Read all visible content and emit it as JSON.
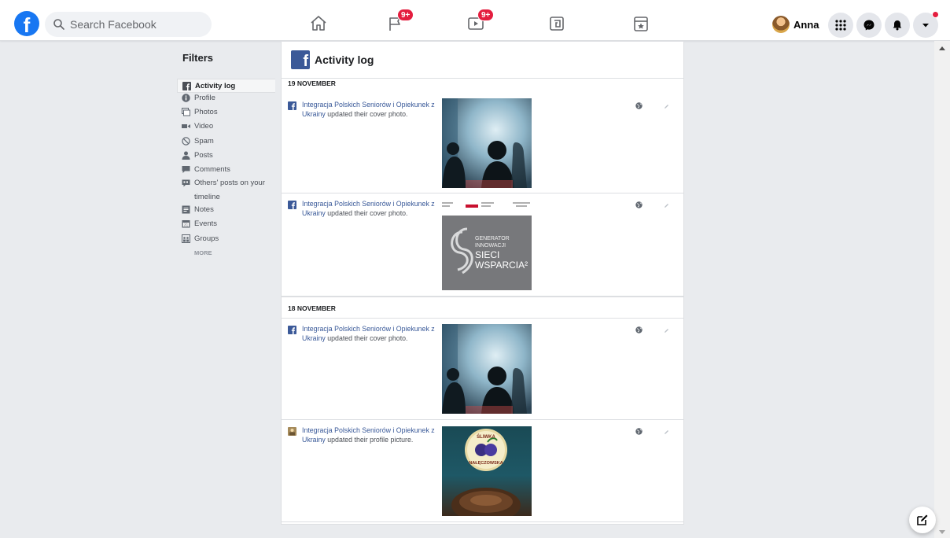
{
  "topbar": {
    "logo_icon": "facebook-logo-icon",
    "search_placeholder": "Search Facebook",
    "nav_items": [
      {
        "name": "home",
        "icon": "home-icon"
      },
      {
        "name": "pages",
        "icon": "flag-icon",
        "badge": "9+"
      },
      {
        "name": "watch",
        "icon": "video-icon",
        "badge": "9+"
      },
      {
        "name": "groups",
        "icon": "groups-icon"
      },
      {
        "name": "gaming",
        "icon": "star-calendar-icon"
      }
    ],
    "profile_name": "Anna",
    "right_buttons": [
      "menu-grid-icon",
      "messenger-icon",
      "notifications-icon",
      "account-caret-icon"
    ]
  },
  "filters": {
    "title": "Filters",
    "items": [
      {
        "label": "Activity log",
        "icon": "facebook-square-icon",
        "active": true
      },
      {
        "label": "Profile",
        "icon": "info-circle-icon"
      },
      {
        "label": "Photos",
        "icon": "photos-icon"
      },
      {
        "label": "Video",
        "icon": "video-camera-icon"
      },
      {
        "label": "Spam",
        "icon": "block-icon"
      },
      {
        "label": "Posts",
        "icon": "person-icon"
      },
      {
        "label": "Comments",
        "icon": "comment-icon"
      },
      {
        "label": "Others' posts on your timeline",
        "icon": "speech-bubble-icon"
      },
      {
        "label": "Notes",
        "icon": "note-icon"
      },
      {
        "label": "Events",
        "icon": "calendar-icon"
      },
      {
        "label": "Groups",
        "icon": "group-icon"
      }
    ],
    "more_label": "MORE"
  },
  "activity_log": {
    "title": "Activity log",
    "days": [
      {
        "label": "19 NOVEMBER",
        "entries": [
          {
            "actor": "Integracja Polskich Seniorów i Opiekunek z Ukrainy",
            "action": " updated their cover photo.",
            "thumb": "concert-photo"
          },
          {
            "actor": "Integracja Polskich Seniorów i Opiekunek z Ukrainy",
            "action": " updated their cover photo.",
            "thumb": "generator-graphic",
            "graphic_lines": [
              "GENERATOR",
              "INNOWACJI",
              "SIECI",
              "WSPARCIA²"
            ]
          }
        ]
      },
      {
        "label": "18 NOVEMBER",
        "entries": [
          {
            "actor": "Integracja Polskich Seniorów i Opiekunek z Ukrainy",
            "action": " updated their cover photo.",
            "thumb": "concert-photo"
          },
          {
            "actor": "Integracja Polskich Seniorów i Opiekunek z Ukrainy",
            "action": " updated their profile picture.",
            "thumb": "plum-photo",
            "graphic_lines": [
              "ŚLIWKA",
              "NAŁĘCZOWSKA"
            ]
          }
        ]
      }
    ]
  },
  "colors": {
    "brand_blue": "#1877f2",
    "classic_blue": "#3b5998",
    "link_blue": "#385898",
    "badge_red": "#e41e3f",
    "page_bg": "#e9ebee"
  }
}
